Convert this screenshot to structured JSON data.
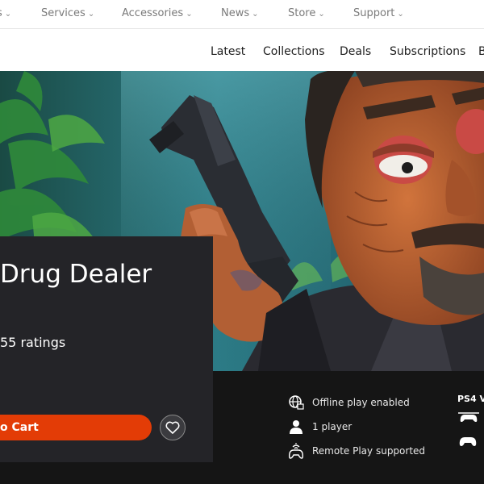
{
  "top_nav": {
    "items": [
      {
        "label": "s",
        "chevron": true
      },
      {
        "label": "Services",
        "chevron": true
      },
      {
        "label": "Accessories",
        "chevron": true
      },
      {
        "label": "News",
        "chevron": true
      },
      {
        "label": "Store",
        "chevron": true
      },
      {
        "label": "Support",
        "chevron": true
      }
    ]
  },
  "sub_nav": {
    "items": [
      {
        "label": "Latest"
      },
      {
        "label": "Collections"
      },
      {
        "label": "Deals"
      },
      {
        "label": "Subscriptions"
      },
      {
        "label": "B"
      }
    ]
  },
  "product": {
    "title": "Drug Dealer",
    "ratings": "55 ratings",
    "add_to_cart_label": "o Cart"
  },
  "features": [
    {
      "icon": "globe-offline-icon",
      "label": "Offline play enabled"
    },
    {
      "icon": "player-icon",
      "label": "1 player"
    },
    {
      "icon": "remote-play-icon",
      "label": "Remote Play supported"
    }
  ],
  "platform": {
    "label": "PS4 V",
    "icons": [
      "controller-vibration-icon",
      "controller-icon"
    ]
  },
  "colors": {
    "cart_button": "#e33c06",
    "panel_bg": "#242428",
    "page_bg": "#151515",
    "nav_bg": "#ffffff"
  }
}
